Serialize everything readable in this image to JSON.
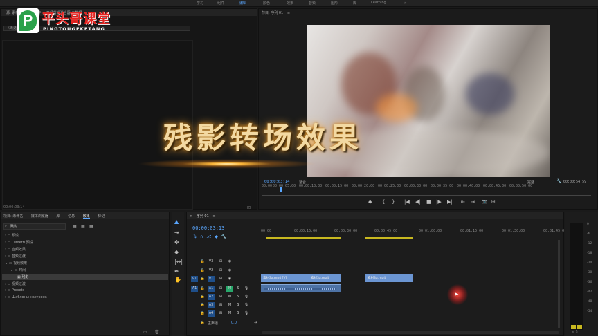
{
  "workspaces": {
    "learn": "学习",
    "assembly": "组件",
    "editing": "编辑",
    "color": "颜色",
    "effects": "效果",
    "audio": "音频",
    "graphics": "图形",
    "libraries": "库",
    "learning": "Learning"
  },
  "brand": {
    "name": "平头哥课堂",
    "pinyin": "PINGTOUGEKETANG",
    "letter": "P",
    "color": "#e52320"
  },
  "source": {
    "tabs": "源: 素材... ≡ 效果控件 ≡ 音频剪辑混合器 元数据",
    "dropdown": "（无选）",
    "timecode": "00:00:03:14"
  },
  "program": {
    "title": "节目: 序列 01",
    "menu": "≡",
    "timecode": "00:00:03:14",
    "fit": "适合",
    "quality": "完整",
    "duration": "00:00:54:59"
  },
  "program_ruler": [
    "00:00",
    "00:00:05:00",
    "00:00:10:00",
    "00:00:15:00",
    "00:00:20:00",
    "00:00:25:00",
    "00:00:30:00",
    "00:00:35:00",
    "00:00:40:00",
    "00:00:45:00",
    "00:00:50:00"
  ],
  "controls": [
    "◆",
    "{",
    "}",
    "|◀",
    "◀|",
    "■",
    "|▶",
    "▶|",
    "⇤",
    "⇥",
    "📷",
    "⊞"
  ],
  "project": {
    "tabs": [
      "项目: 未命名",
      "媒体浏览器",
      "库",
      "信息",
      "效果",
      "标记"
    ],
    "search_value": "残影",
    "tree": [
      "预设",
      "Lumetri 预设",
      "音频效果",
      "音频过渡",
      "视频效果",
      "时间",
      "残影",
      "视频过渡",
      "Presets",
      "Шаблоны настроек"
    ]
  },
  "timeline": {
    "tab": "序列 01",
    "timecode": "00:00:03:13",
    "ruler": [
      "00:00",
      "00:00:15:00",
      "00:00:30:00",
      "00:00:45:00",
      "00:01:00:00",
      "00:01:15:00",
      "00:01:30:00",
      "00:01:45:0"
    ],
    "tracks": [
      "V3",
      "V2",
      "V1",
      "A1",
      "A2",
      "A3",
      "A4"
    ],
    "master": "主声道",
    "master_value": "0.0",
    "clips": [
      "素材3a.mp4 [V]",
      "素材3a.mp4",
      "素材3a.mp4"
    ]
  },
  "meter": {
    "labels": [
      "0",
      "-6",
      "-12",
      "-18",
      "-24",
      "-30",
      "-36",
      "-42",
      "-48",
      "-54"
    ],
    "footer": "S  S"
  },
  "overlay": {
    "title": "残影转场效果"
  }
}
